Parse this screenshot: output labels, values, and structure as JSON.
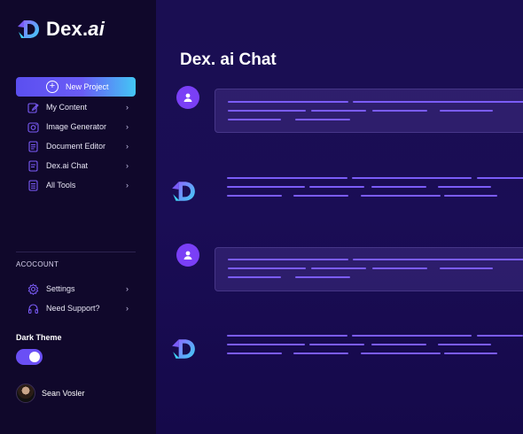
{
  "brand": {
    "name_main": "Dex.",
    "name_ai": "ai"
  },
  "sidebar": {
    "new_project_label": "New Project",
    "nav": [
      {
        "label": "My Content",
        "icon": "edit-icon"
      },
      {
        "label": "Image Generator",
        "icon": "image-icon"
      },
      {
        "label": "Document Editor",
        "icon": "document-icon"
      },
      {
        "label": "Dex.ai Chat",
        "icon": "chat-icon"
      },
      {
        "label": "All Tools",
        "icon": "tools-icon"
      }
    ],
    "account_section_label": "ACOCOUNT",
    "account": [
      {
        "label": "Settings",
        "icon": "gear-icon"
      },
      {
        "label": "Need Support?",
        "icon": "headphones-icon"
      }
    ],
    "theme_label": "Dark Theme",
    "theme_on": true,
    "user_name": "Sean Vosler"
  },
  "main": {
    "title": "Dex. ai Chat"
  },
  "colors": {
    "accent": "#6a4ff5",
    "accent_cyan": "#43c7f5",
    "line": "#7b5cf8",
    "sidebar_bg": "#10082b",
    "main_bg": "#1a0e52"
  }
}
